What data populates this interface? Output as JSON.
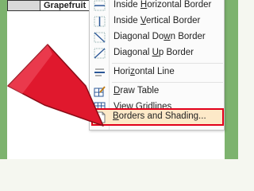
{
  "table": {
    "cell_label": "Grapefruit"
  },
  "menu": {
    "items": [
      {
        "before": "Inside ",
        "u": "H",
        "after": "orizontal Border",
        "icon": "inside-horizontal-border-icon"
      },
      {
        "before": "Inside ",
        "u": "V",
        "after": "ertical Border",
        "icon": "inside-vertical-border-icon"
      },
      {
        "before": "Diagonal Do",
        "u": "w",
        "after": "n Border",
        "icon": "diagonal-down-border-icon"
      },
      {
        "before": "Diagonal ",
        "u": "U",
        "after": "p Border",
        "icon": "diagonal-up-border-icon"
      },
      {
        "before": "Hori",
        "u": "z",
        "after": "ontal Line",
        "icon": "horizontal-line-icon"
      },
      {
        "before": "",
        "u": "D",
        "after": "raw Table",
        "icon": "draw-table-icon"
      },
      {
        "before": "View ",
        "u": "G",
        "after": "ridlines",
        "icon": "view-gridlines-icon"
      },
      {
        "before": "",
        "u": "B",
        "after": "orders and Shading...",
        "icon": "borders-shading-icon"
      }
    ]
  },
  "colors": {
    "highlight_border": "#e2001a",
    "arrow": "#e0182d",
    "side_bars": "#7db36e"
  }
}
